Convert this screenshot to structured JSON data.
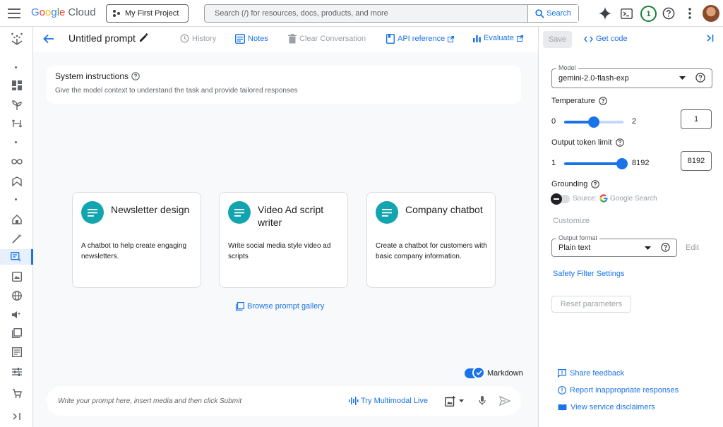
{
  "topbar": {
    "logo_google": "Google",
    "logo_cloud": "Cloud",
    "project": "My First Project",
    "search_placeholder": "Search (/) for resources, docs, products, and more",
    "search_button": "Search",
    "notifications_count": "1"
  },
  "header": {
    "title": "Untitled prompt",
    "actions": {
      "history": "History",
      "notes": "Notes",
      "clear": "Clear Conversation",
      "api_reference": "API reference",
      "evaluate": "Evaluate"
    }
  },
  "system_instructions": {
    "title": "System instructions",
    "description": "Give the model context to understand the task and provide tailored responses"
  },
  "cards": [
    {
      "title": "Newsletter design",
      "desc": "A chatbot to help create engaging newsletters."
    },
    {
      "title": "Video Ad script writer",
      "desc": "Write social media style video ad scripts"
    },
    {
      "title": "Company chatbot",
      "desc": "Create a chatbot for customers with basic company information."
    }
  ],
  "browse_gallery": "Browse prompt gallery",
  "markdown_label": "Markdown",
  "prompt": {
    "placeholder": "Write your prompt here, insert media and then click Submit",
    "live_label": "Try Multimodal Live"
  },
  "panel": {
    "save": "Save",
    "get_code": "Get code",
    "model_label": "Model",
    "model_value": "gemini-2.0-flash-exp",
    "temperature_label": "Temperature",
    "temperature_min": "0",
    "temperature_max": "2",
    "temperature_value": "1",
    "token_label": "Output token limit",
    "token_min": "1",
    "token_max": "8192",
    "token_value": "8192",
    "grounding_label": "Grounding",
    "grounding_source": "Source:",
    "grounding_google": "Google Search",
    "customize": "Customize",
    "output_format_label": "Output format",
    "output_format_value": "Plain text",
    "edit": "Edit",
    "safety": "Safety Filter Settings",
    "reset": "Reset parameters",
    "share_feedback": "Share feedback",
    "report": "Report inappropriate responses",
    "disclaimers": "View service disclaimers"
  },
  "colors": {
    "accent": "#1a73e8",
    "card_icon": "#12a4af",
    "badge": "#188038"
  }
}
